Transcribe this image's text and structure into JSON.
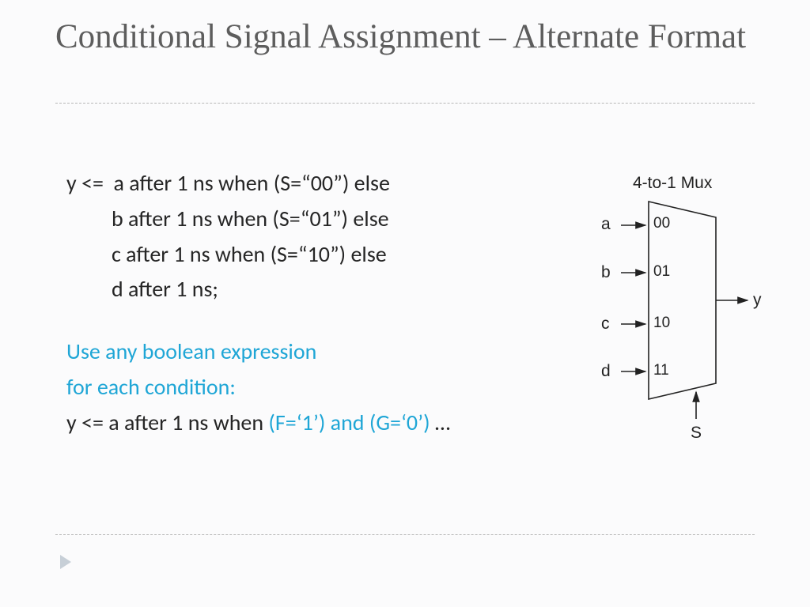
{
  "title": "Conditional Signal Assignment – Alternate Format",
  "code": {
    "l1": "y <=  a after 1 ns when (S=“00”) else",
    "l2": "         b after 1 ns when (S=“01”) else",
    "l3": "         c after 1 ns when (S=“10”) else",
    "l4": "         d after 1 ns;"
  },
  "note": {
    "line1": "Use any boolean expression",
    "line2": "for each condition:"
  },
  "example": {
    "prefix": "y <= a after 1 ns when ",
    "cond": "(F=‘1’) and (G=‘0’)",
    "suffix": " …"
  },
  "mux": {
    "title": "4-to-1 Mux",
    "inputs": [
      "a",
      "b",
      "c",
      "d"
    ],
    "ports": [
      "00",
      "01",
      "10",
      "11"
    ],
    "output": "y",
    "select": "S"
  },
  "colors": {
    "accent": "#1fa6d6",
    "title": "#5d5d5d"
  }
}
